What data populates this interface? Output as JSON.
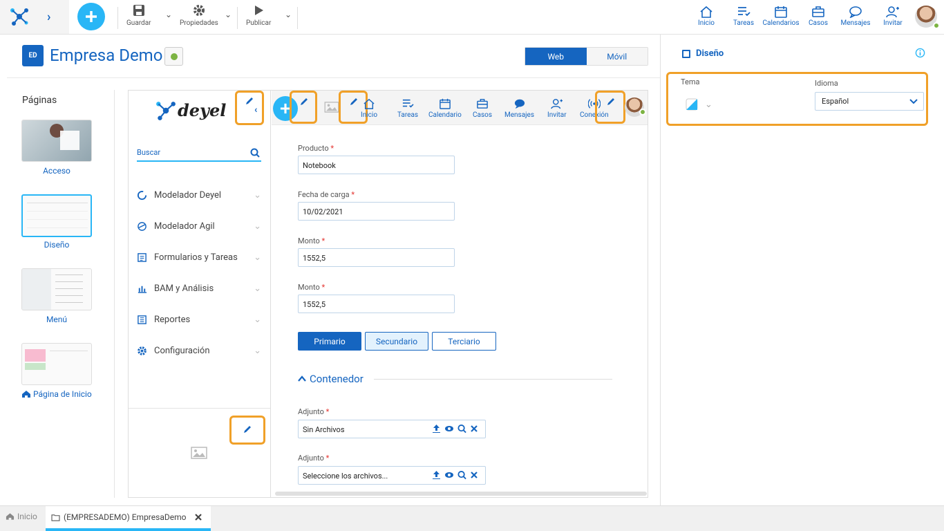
{
  "toolbar": {
    "save_label": "Guardar",
    "properties_label": "Propiedades",
    "publish_label": "Publicar"
  },
  "topnav": {
    "items": [
      {
        "label": "Inicio",
        "icon": "home-icon"
      },
      {
        "label": "Tareas",
        "icon": "tasks-icon"
      },
      {
        "label": "Calendarios",
        "icon": "calendar-icon"
      },
      {
        "label": "Casos",
        "icon": "briefcase-icon"
      },
      {
        "label": "Mensajes",
        "icon": "chat-icon"
      },
      {
        "label": "Invitar",
        "icon": "invite-user-icon"
      }
    ]
  },
  "header": {
    "badge": "ED",
    "title": "Empresa Demo",
    "toggle": {
      "web": "Web",
      "mobile": "Móvil"
    }
  },
  "pages": {
    "title": "Páginas",
    "items": [
      {
        "label": "Acceso"
      },
      {
        "label": "Diseño"
      },
      {
        "label": "Menú"
      },
      {
        "label": "Página de Inicio"
      }
    ]
  },
  "preview": {
    "brand": "deyel",
    "search_placeholder": "Buscar",
    "menu": [
      {
        "label": "Modelador Deyel",
        "icon": "circle-loader-icon"
      },
      {
        "label": "Modelador Agil",
        "icon": "agile-icon"
      },
      {
        "label": "Formularios y Tareas",
        "icon": "forms-icon"
      },
      {
        "label": "BAM y Análisis",
        "icon": "bar-chart-icon"
      },
      {
        "label": "Reportes",
        "icon": "report-icon"
      },
      {
        "label": "Configuración",
        "icon": "gear-icon"
      }
    ],
    "nav": [
      {
        "label": "Inicio"
      },
      {
        "label": "Tareas"
      },
      {
        "label": "Calendario"
      },
      {
        "label": "Casos"
      },
      {
        "label": "Mensajes"
      },
      {
        "label": "Invitar"
      },
      {
        "label": "Conexión"
      }
    ],
    "form": {
      "fields": [
        {
          "label": "Producto",
          "value": "Notebook"
        },
        {
          "label": "Fecha de carga",
          "value": "10/02/2021"
        },
        {
          "label": "Monto",
          "value": "1552,5"
        },
        {
          "label": "Monto",
          "value": "1552,5"
        }
      ],
      "buttons": {
        "primary": "Primario",
        "secondary": "Secundario",
        "tertiary": "Terciario"
      },
      "container": "Contenedor",
      "attachments": [
        {
          "label": "Adjunto",
          "value": "Sin Archivos"
        },
        {
          "label": "Adjunto",
          "value": "Seleccione los archivos..."
        }
      ],
      "required_mark": "*"
    }
  },
  "design_panel": {
    "title": "Diseño",
    "theme_label": "Tema",
    "language_label": "Idioma",
    "language_value": "Español"
  },
  "bottom": {
    "home": "Inicio",
    "tab": "(EMPRESADEMO) EmpresaDemo"
  },
  "colors": {
    "brand": "#1565c0",
    "accent": "#29b6f6",
    "highlight": "#f0a028",
    "status_green": "#7cb342"
  }
}
